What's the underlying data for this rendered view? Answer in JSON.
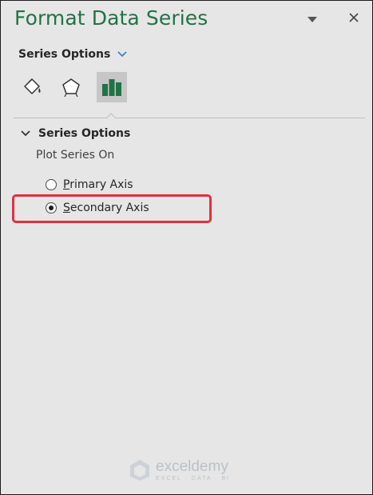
{
  "pane": {
    "title": "Format Data Series",
    "title_color": "#217346"
  },
  "series_options_menu": {
    "label": "Series Options",
    "chevron_color": "#2b7cd3"
  },
  "tabs": [
    {
      "name": "fill-line",
      "icon": "paint-bucket-icon",
      "active": false
    },
    {
      "name": "effects",
      "icon": "pentagon-icon",
      "active": false
    },
    {
      "name": "series-options",
      "icon": "bar-chart-icon",
      "active": true
    }
  ],
  "section": {
    "title": "Series Options",
    "plot_label": "Plot Series On",
    "options": [
      {
        "accel": "P",
        "rest": "rimary Axis",
        "checked": false
      },
      {
        "accel": "S",
        "rest": "econdary Axis",
        "checked": true
      }
    ]
  },
  "highlight_color": "#e0313d",
  "watermark": {
    "name": "exceldemy",
    "tagline": "EXCEL · DATA · BI"
  }
}
